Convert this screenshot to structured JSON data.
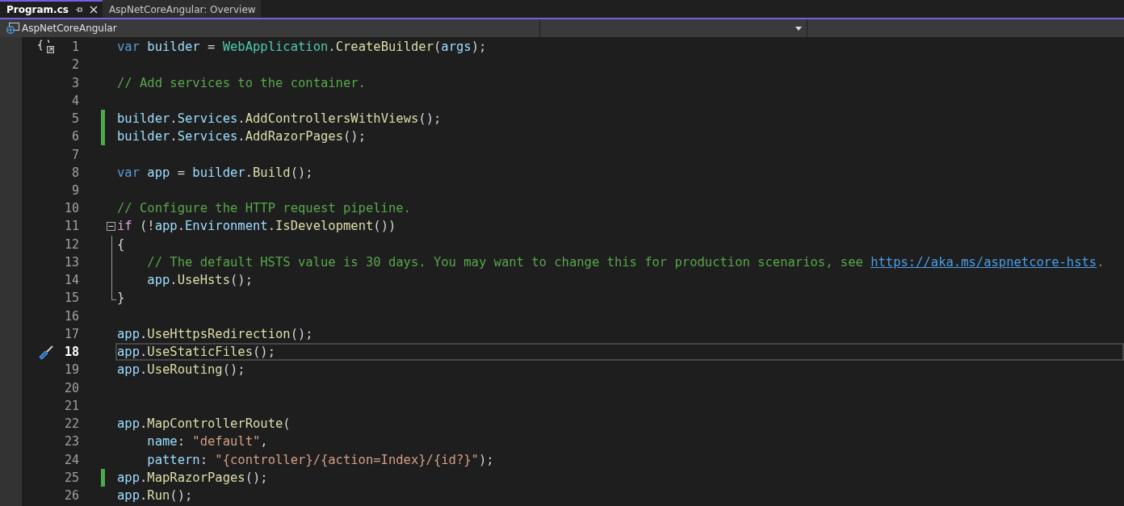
{
  "tabs": [
    {
      "label": "Program.cs",
      "selected": true
    },
    {
      "label": "AspNetCoreAngular: Overview",
      "selected": false
    }
  ],
  "navigation_bar": {
    "project": "AspNetCoreAngular"
  },
  "lines": [
    {
      "number": "1",
      "code_lens": true,
      "tokens": [
        {
          "kind": "keyword",
          "text": "var "
        },
        {
          "kind": "ident",
          "text": "builder"
        },
        {
          "kind": "plain",
          "text": " = "
        },
        {
          "kind": "type",
          "text": "WebApplication"
        },
        {
          "kind": "plain",
          "text": "."
        },
        {
          "kind": "method",
          "text": "CreateBuilder"
        },
        {
          "kind": "plain",
          "text": "("
        },
        {
          "kind": "ident",
          "text": "args"
        },
        {
          "kind": "plain",
          "text": ");"
        }
      ]
    },
    {
      "number": "2"
    },
    {
      "number": "3",
      "tokens": [
        {
          "kind": "comment",
          "text": "// Add services to the container."
        }
      ]
    },
    {
      "number": "4"
    },
    {
      "number": "5",
      "changed": true,
      "tokens": [
        {
          "kind": "ident",
          "text": "builder"
        },
        {
          "kind": "plain",
          "text": "."
        },
        {
          "kind": "ident",
          "text": "Services"
        },
        {
          "kind": "plain",
          "text": "."
        },
        {
          "kind": "method",
          "text": "AddControllersWithViews"
        },
        {
          "kind": "plain",
          "text": "();"
        }
      ]
    },
    {
      "number": "6",
      "changed": true,
      "tokens": [
        {
          "kind": "ident",
          "text": "builder"
        },
        {
          "kind": "plain",
          "text": "."
        },
        {
          "kind": "ident",
          "text": "Services"
        },
        {
          "kind": "plain",
          "text": "."
        },
        {
          "kind": "method",
          "text": "AddRazorPages"
        },
        {
          "kind": "plain",
          "text": "();"
        }
      ]
    },
    {
      "number": "7"
    },
    {
      "number": "8",
      "tokens": [
        {
          "kind": "keyword",
          "text": "var "
        },
        {
          "kind": "ident",
          "text": "app"
        },
        {
          "kind": "plain",
          "text": " = "
        },
        {
          "kind": "ident",
          "text": "builder"
        },
        {
          "kind": "plain",
          "text": "."
        },
        {
          "kind": "method",
          "text": "Build"
        },
        {
          "kind": "plain",
          "text": "();"
        }
      ]
    },
    {
      "number": "9"
    },
    {
      "number": "10",
      "tokens": [
        {
          "kind": "comment",
          "text": "// Configure the HTTP request pipeline."
        }
      ]
    },
    {
      "number": "11",
      "fold_start": true,
      "expanded": true,
      "tokens": [
        {
          "kind": "control",
          "text": "if"
        },
        {
          "kind": "plain",
          "text": " (!"
        },
        {
          "kind": "ident",
          "text": "app"
        },
        {
          "kind": "plain",
          "text": "."
        },
        {
          "kind": "ident",
          "text": "Environment"
        },
        {
          "kind": "plain",
          "text": "."
        },
        {
          "kind": "method",
          "text": "IsDevelopment"
        },
        {
          "kind": "plain",
          "text": "())"
        }
      ]
    },
    {
      "number": "12",
      "in_fold": true,
      "tokens": [
        {
          "kind": "plain",
          "text": "{"
        }
      ]
    },
    {
      "number": "13",
      "in_fold": true,
      "indented": true,
      "tokens": [
        {
          "kind": "comment",
          "text": "// The default HSTS value is 30 days. You may want to change this for production scenarios, see "
        },
        {
          "kind": "link",
          "text": "https://aka.ms/aspnetcore-hsts"
        },
        {
          "kind": "comment",
          "text": "."
        }
      ]
    },
    {
      "number": "14",
      "in_fold": true,
      "indented": true,
      "tokens": [
        {
          "kind": "ident",
          "text": "app"
        },
        {
          "kind": "plain",
          "text": "."
        },
        {
          "kind": "method",
          "text": "UseHsts"
        },
        {
          "kind": "plain",
          "text": "();"
        }
      ]
    },
    {
      "number": "15",
      "in_fold": true,
      "fold_end": true,
      "tokens": [
        {
          "kind": "plain",
          "text": "}"
        }
      ]
    },
    {
      "number": "16"
    },
    {
      "number": "17",
      "tokens": [
        {
          "kind": "ident",
          "text": "app"
        },
        {
          "kind": "plain",
          "text": "."
        },
        {
          "kind": "method",
          "text": "UseHttpsRedirection"
        },
        {
          "kind": "plain",
          "text": "();"
        }
      ]
    },
    {
      "number": "18",
      "current": true,
      "quick_actions": true,
      "tokens": [
        {
          "kind": "ident",
          "text": "app"
        },
        {
          "kind": "plain",
          "text": "."
        },
        {
          "kind": "method",
          "text": "UseStaticFiles"
        },
        {
          "kind": "plain",
          "text": "();"
        }
      ]
    },
    {
      "number": "19",
      "tokens": [
        {
          "kind": "ident",
          "text": "app"
        },
        {
          "kind": "plain",
          "text": "."
        },
        {
          "kind": "method",
          "text": "UseRouting"
        },
        {
          "kind": "plain",
          "text": "();"
        }
      ]
    },
    {
      "number": "20"
    },
    {
      "number": "21"
    },
    {
      "number": "22",
      "tokens": [
        {
          "kind": "ident",
          "text": "app"
        },
        {
          "kind": "plain",
          "text": "."
        },
        {
          "kind": "method",
          "text": "MapControllerRoute"
        },
        {
          "kind": "plain",
          "text": "("
        }
      ]
    },
    {
      "number": "23",
      "indented": true,
      "tokens": [
        {
          "kind": "ident",
          "text": "name"
        },
        {
          "kind": "plain",
          "text": ": "
        },
        {
          "kind": "string",
          "text": "\"default\""
        },
        {
          "kind": "plain",
          "text": ","
        }
      ]
    },
    {
      "number": "24",
      "indented": true,
      "tokens": [
        {
          "kind": "ident",
          "text": "pattern"
        },
        {
          "kind": "plain",
          "text": ": "
        },
        {
          "kind": "string",
          "text": "\"{controller}/{action=Index}/{id?}\""
        },
        {
          "kind": "plain",
          "text": ");"
        }
      ]
    },
    {
      "number": "25",
      "changed": true,
      "tokens": [
        {
          "kind": "ident",
          "text": "app"
        },
        {
          "kind": "plain",
          "text": "."
        },
        {
          "kind": "method",
          "text": "MapRazorPages"
        },
        {
          "kind": "plain",
          "text": "();"
        }
      ]
    },
    {
      "number": "26",
      "tokens": [
        {
          "kind": "ident",
          "text": "app"
        },
        {
          "kind": "plain",
          "text": "."
        },
        {
          "kind": "method",
          "text": "Run"
        },
        {
          "kind": "plain",
          "text": "();"
        }
      ]
    }
  ]
}
